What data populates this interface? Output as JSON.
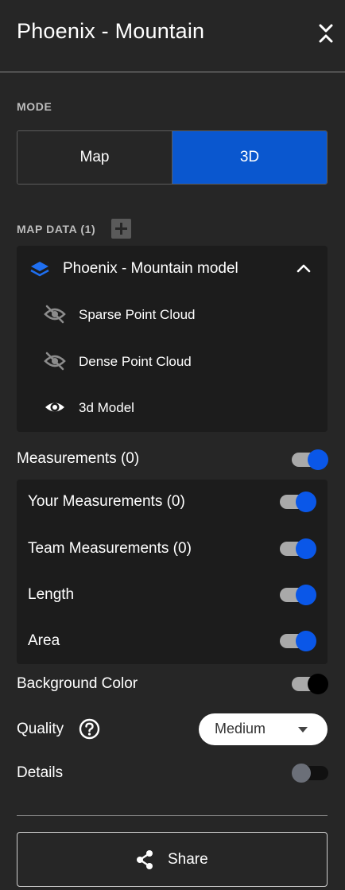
{
  "header": {
    "title": "Phoenix - Mountain"
  },
  "mode": {
    "label": "MODE",
    "options": [
      "Map",
      "3D"
    ],
    "selected": "3D"
  },
  "map_data": {
    "label": "MAP DATA (1)",
    "model": {
      "name": "Phoenix - Mountain model",
      "expanded": true,
      "layers": [
        {
          "label": "Sparse Point Cloud",
          "visible": false,
          "icon": "eye-off-icon"
        },
        {
          "label": "Dense Point Cloud",
          "visible": false,
          "icon": "eye-off-icon"
        },
        {
          "label": "3d Model",
          "visible": true,
          "icon": "eye-icon"
        }
      ]
    }
  },
  "measurements": {
    "label": "Measurements (0)",
    "enabled": true,
    "items": [
      {
        "label": "Your Measurements (0)",
        "enabled": true
      },
      {
        "label": "Team Measurements (0)",
        "enabled": true
      },
      {
        "label": "Length",
        "enabled": true
      },
      {
        "label": "Area",
        "enabled": true
      }
    ]
  },
  "background_color": {
    "label": "Background Color",
    "value": "black"
  },
  "quality": {
    "label": "Quality",
    "selected": "Medium"
  },
  "details": {
    "label": "Details",
    "enabled": false
  },
  "share": {
    "label": "Share"
  },
  "colors": {
    "background": "#262626",
    "accent": "#0a57cf",
    "panel": "#1c1c1c"
  }
}
